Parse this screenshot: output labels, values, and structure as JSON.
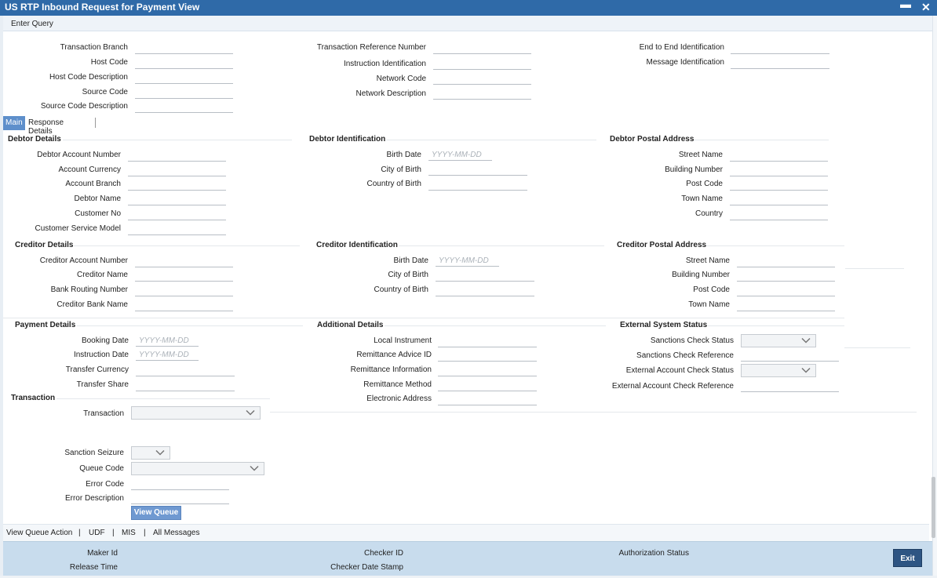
{
  "window": {
    "title": "US RTP Inbound Request for Payment View",
    "minimize_glyph": "▬",
    "close_glyph": "✕"
  },
  "toolbar": {
    "enter_query": "Enter Query"
  },
  "header": {
    "transaction_branch": "Transaction Branch",
    "host_code": "Host Code",
    "host_code_description": "Host Code Description",
    "source_code": "Source Code",
    "source_code_description": "Source Code Description",
    "transaction_reference_number": "Transaction Reference Number",
    "instruction_identification": "Instruction Identification",
    "network_code": "Network Code",
    "network_description": "Network Description",
    "end_to_end_identification": "End to End Identification",
    "message_identification": "Message Identification"
  },
  "tabs": {
    "main": "Main",
    "response_details": "Response Details"
  },
  "debtor": {
    "section": "Debtor Details",
    "account_number": "Debtor Account Number",
    "account_currency": "Account Currency",
    "account_branch": "Account Branch",
    "name": "Debtor Name",
    "customer_no": "Customer No",
    "customer_service_model": "Customer Service Model"
  },
  "debtor_identification": {
    "section": "Debtor Identification",
    "birth_date": "Birth Date",
    "birth_date_placeholder": "YYYY-MM-DD",
    "city_of_birth": "City of Birth",
    "country_of_birth": "Country of Birth"
  },
  "debtor_postal": {
    "section": "Debtor Postal Address",
    "street_name": "Street Name",
    "building_number": "Building Number",
    "post_code": "Post Code",
    "town_name": "Town Name",
    "country": "Country"
  },
  "creditor": {
    "section": "Creditor Details",
    "account_number": "Creditor Account Number",
    "name": "Creditor Name",
    "bank_routing_number": "Bank Routing Number",
    "bank_name": "Creditor Bank Name"
  },
  "creditor_identification": {
    "section": "Creditor Identification",
    "birth_date": "Birth Date",
    "birth_date_placeholder": "YYYY-MM-DD",
    "city_of_birth": "City of Birth",
    "country_of_birth": "Country of Birth"
  },
  "creditor_postal": {
    "section": "Creditor Postal Address",
    "street_name": "Street Name",
    "building_number": "Building Number",
    "post_code": "Post Code",
    "town_name": "Town Name"
  },
  "payment": {
    "section": "Payment Details",
    "booking_date": "Booking Date",
    "instruction_date": "Instruction Date",
    "date_placeholder": "YYYY-MM-DD",
    "transfer_currency": "Transfer Currency",
    "transfer_share": "Transfer Share"
  },
  "additional": {
    "section": "Additional Details",
    "local_instrument": "Local Instrument",
    "remittance_advice_id": "Remittance Advice ID",
    "remittance_information": "Remittance Information",
    "remittance_method": "Remittance Method",
    "electronic_address": "Electronic Address"
  },
  "external": {
    "section": "External System Status",
    "sanctions_check_status": "Sanctions Check Status",
    "sanctions_check_reference": "Sanctions Check Reference",
    "external_account_check_status": "External Account Check Status",
    "external_account_check_reference": "External Account Check Reference"
  },
  "transaction": {
    "section": "Transaction",
    "transaction": "Transaction",
    "sanction_seizure": "Sanction Seizure",
    "queue_code": "Queue Code",
    "error_code": "Error Code",
    "error_description": "Error Description",
    "view_queue": "View Queue"
  },
  "links": {
    "view_queue_action": "View Queue Action",
    "udf": "UDF",
    "mis": "MIS",
    "all_messages": "All Messages",
    "separator": "|"
  },
  "footer": {
    "maker_id": "Maker Id",
    "release_time": "Release Time",
    "checker_id": "Checker ID",
    "checker_date_stamp": "Checker Date Stamp",
    "authorization_status": "Authorization Status",
    "exit": "Exit"
  }
}
